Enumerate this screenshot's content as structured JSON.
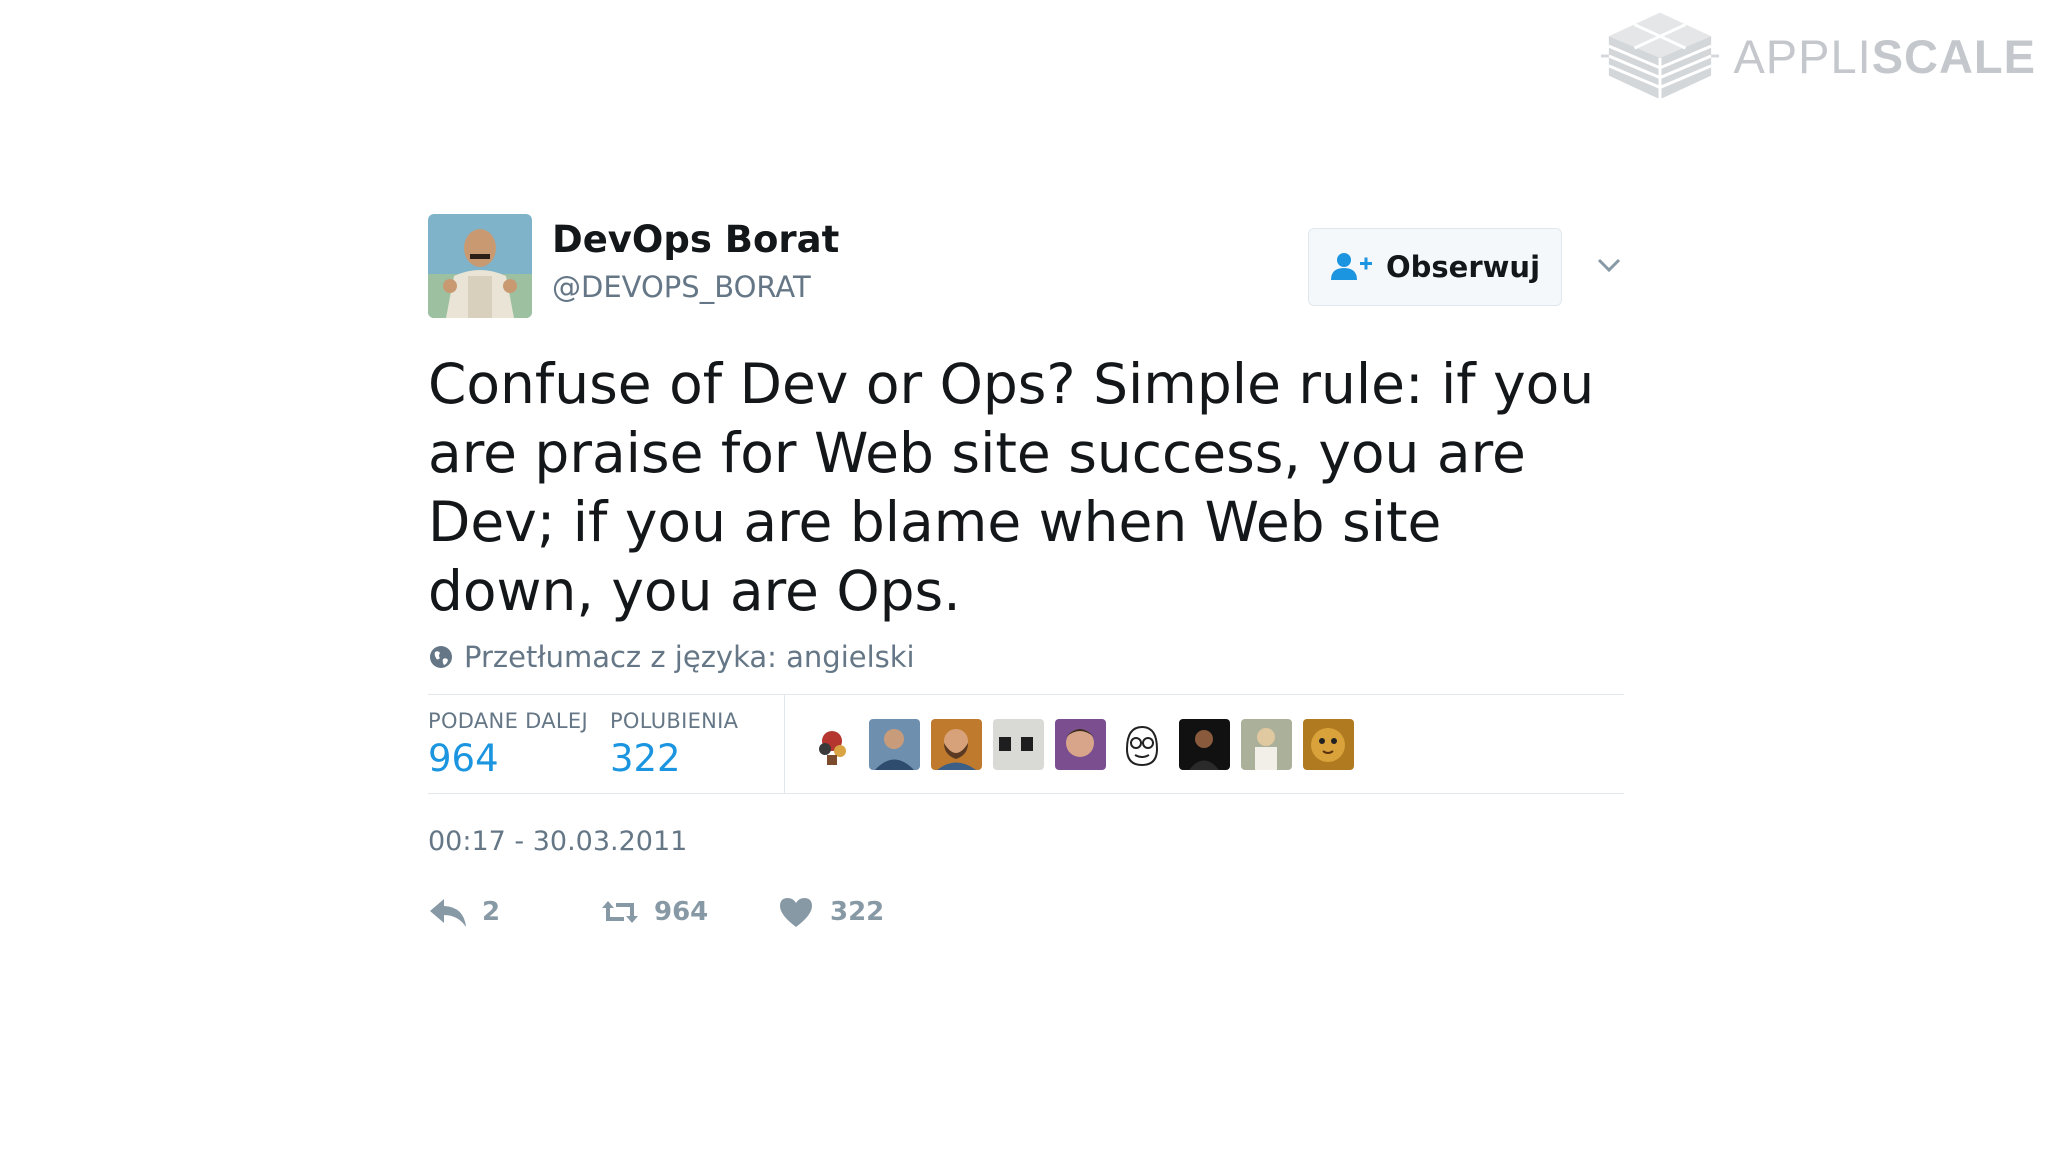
{
  "watermark": {
    "brand_light": "APPLI",
    "brand_bold": "SCALE"
  },
  "tweet": {
    "author_name": "DevOps Borat",
    "author_handle": "@DEVOPS_BORAT",
    "follow_label": "Obserwuj",
    "text": "Confuse of Dev or Ops? Simple rule: if you are praise for Web site success, you are Dev; if you are blame when Web site down, you are Ops.",
    "translate_label": "Przetłumacz z języka: angielski",
    "stats": {
      "retweets_label": "PODANE DALEJ",
      "retweets_value": "964",
      "likes_label": "POLUBIENIA",
      "likes_value": "322"
    },
    "timestamp": "00:17 - 30.03.2011",
    "actions": {
      "reply_count": "2",
      "retweet_count": "964",
      "like_count": "322"
    }
  },
  "icons": [
    "add-user-icon",
    "chevron-down-icon",
    "globe-icon",
    "reply-icon",
    "retweet-icon",
    "heart-icon"
  ],
  "colors": {
    "link_blue": "#1b95e0",
    "muted_gray": "#657786",
    "action_gray": "#8899a6",
    "text_dark": "#14171a"
  }
}
